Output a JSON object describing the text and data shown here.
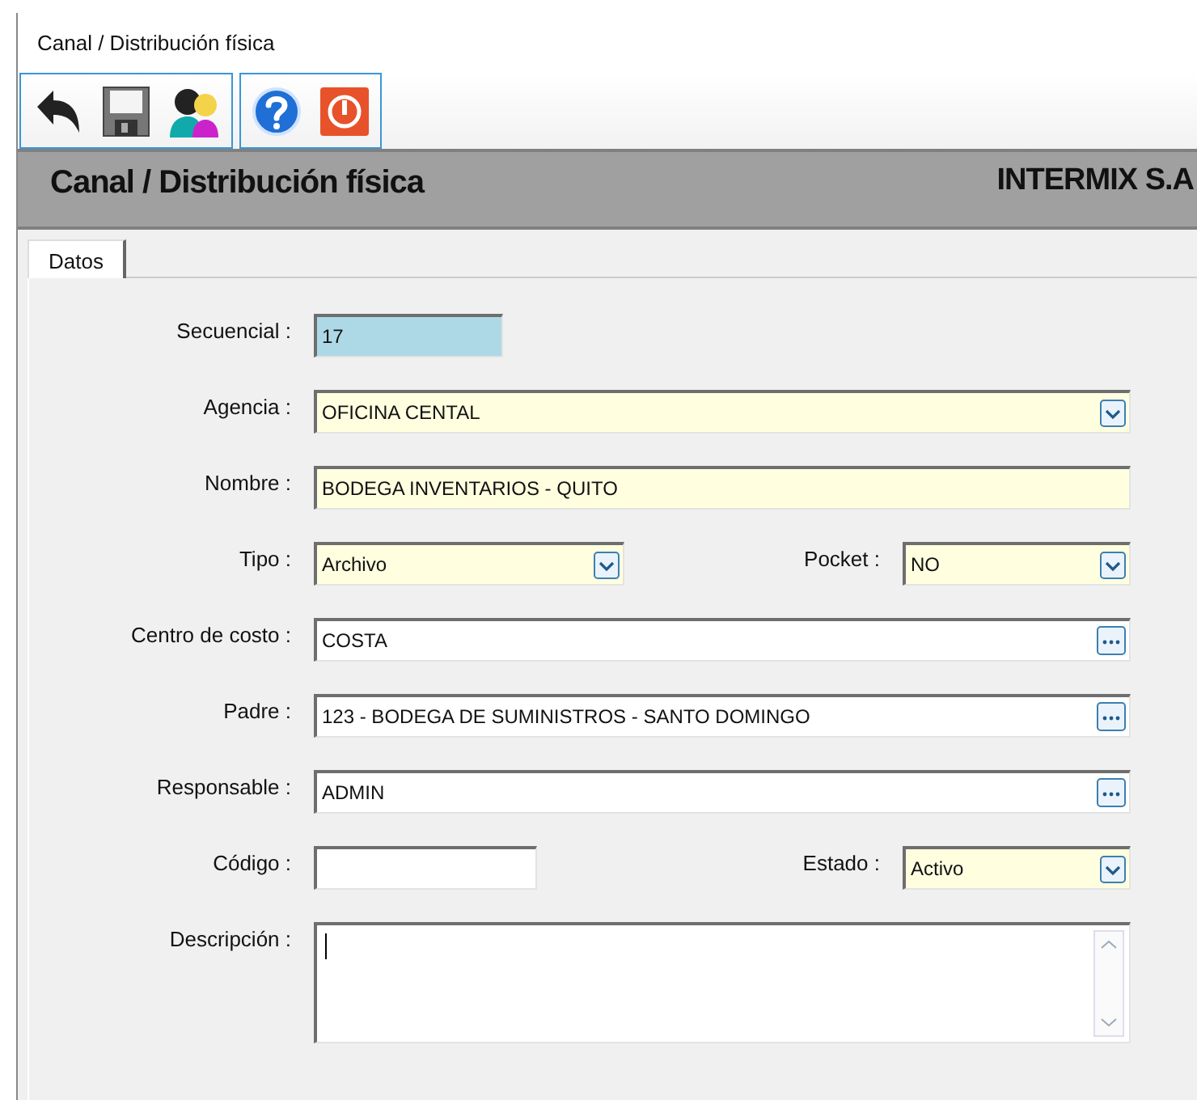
{
  "window": {
    "title": "Canal / Distribución física"
  },
  "toolbar": {
    "groups": [
      {
        "buttons": [
          {
            "kind": "back"
          },
          {
            "kind": "save"
          },
          {
            "kind": "users"
          }
        ]
      },
      {
        "buttons": [
          {
            "kind": "help"
          },
          {
            "kind": "exit"
          }
        ]
      }
    ]
  },
  "header": {
    "title": "Canal / Distribución física",
    "company": "INTERMIX S.A"
  },
  "tabs": [
    {
      "label": "Datos",
      "selected": true
    }
  ],
  "form": {
    "rows": [
      {
        "fields": [
          {
            "label": "Secuencial :",
            "value": "17",
            "kind": "text",
            "readonly": true,
            "required": false
          }
        ]
      },
      {
        "fields": [
          {
            "label": "Agencia :",
            "value": "OFICINA CENTAL",
            "kind": "select",
            "readonly": false,
            "required": true
          }
        ]
      },
      {
        "fields": [
          {
            "label": "Nombre :",
            "value": "BODEGA INVENTARIOS - QUITO",
            "kind": "text",
            "readonly": false,
            "required": true
          }
        ]
      },
      {
        "fields": [
          {
            "label": "Tipo :",
            "value": "Archivo",
            "kind": "select",
            "readonly": false,
            "required": true
          },
          {
            "label": "Pocket :",
            "value": "NO",
            "kind": "select",
            "readonly": false,
            "required": true
          }
        ]
      },
      {
        "fields": [
          {
            "label": "Centro de costo :",
            "value": "COSTA",
            "kind": "lookup",
            "readonly": false,
            "required": false
          }
        ]
      },
      {
        "fields": [
          {
            "label": "Padre :",
            "value": "123 - BODEGA DE SUMINISTROS - SANTO DOMINGO",
            "kind": "lookup",
            "readonly": false,
            "required": false
          }
        ]
      },
      {
        "fields": [
          {
            "label": "Responsable :",
            "value": "ADMIN",
            "kind": "lookup",
            "readonly": false,
            "required": false
          }
        ]
      },
      {
        "fields": [
          {
            "label": "Código :",
            "kind": "text",
            "readonly": false,
            "required": false
          },
          {
            "label": "Estado :",
            "value": "Activo",
            "kind": "select",
            "readonly": false,
            "required": true
          }
        ]
      },
      {
        "fields": [
          {
            "label": "Descripción :",
            "kind": "textarea",
            "readonly": false,
            "required": false,
            "focused": true
          }
        ]
      }
    ]
  }
}
